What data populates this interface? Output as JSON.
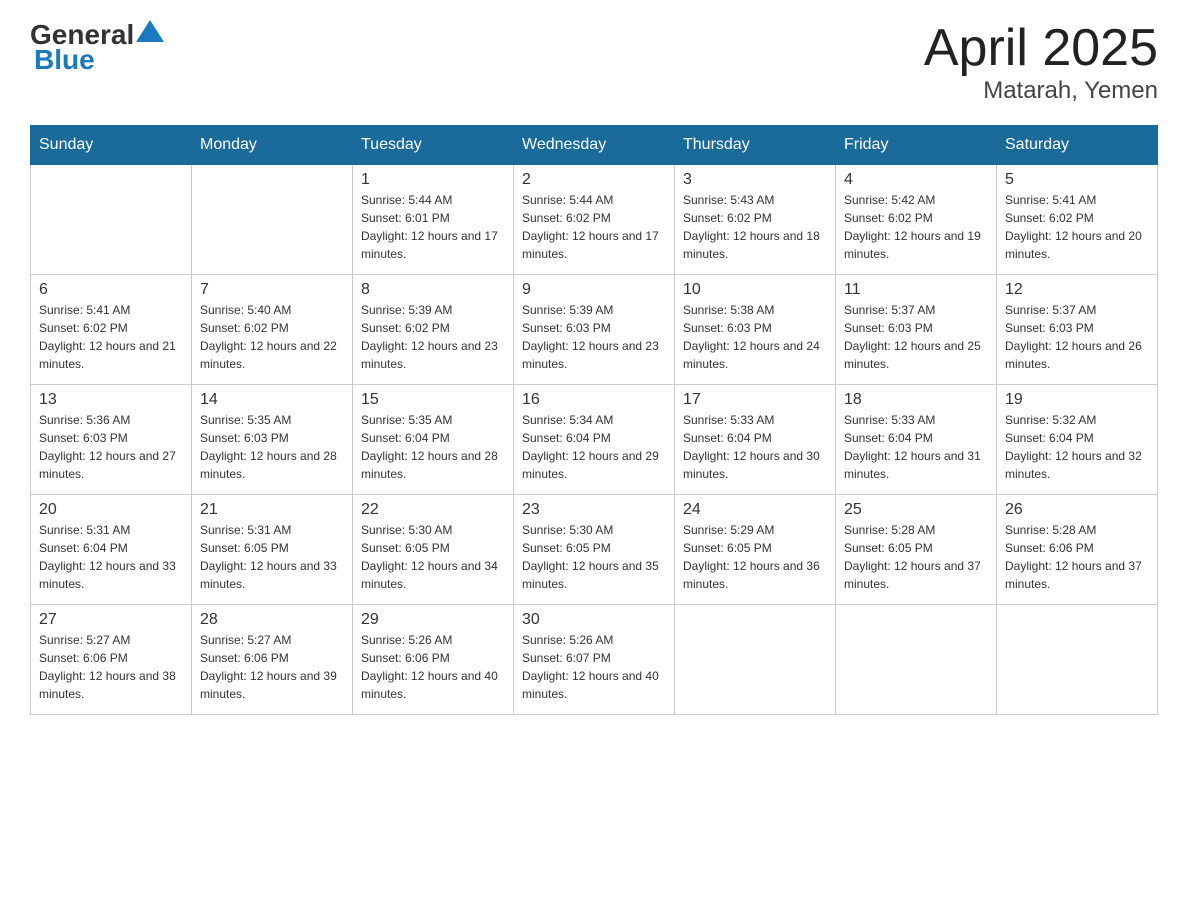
{
  "header": {
    "logo_general": "General",
    "logo_blue": "Blue",
    "title": "April 2025",
    "subtitle": "Matarah, Yemen"
  },
  "days_of_week": [
    "Sunday",
    "Monday",
    "Tuesday",
    "Wednesday",
    "Thursday",
    "Friday",
    "Saturday"
  ],
  "weeks": [
    [
      {
        "day": "",
        "sunrise": "",
        "sunset": "",
        "daylight": ""
      },
      {
        "day": "",
        "sunrise": "",
        "sunset": "",
        "daylight": ""
      },
      {
        "day": "1",
        "sunrise": "Sunrise: 5:44 AM",
        "sunset": "Sunset: 6:01 PM",
        "daylight": "Daylight: 12 hours and 17 minutes."
      },
      {
        "day": "2",
        "sunrise": "Sunrise: 5:44 AM",
        "sunset": "Sunset: 6:02 PM",
        "daylight": "Daylight: 12 hours and 17 minutes."
      },
      {
        "day": "3",
        "sunrise": "Sunrise: 5:43 AM",
        "sunset": "Sunset: 6:02 PM",
        "daylight": "Daylight: 12 hours and 18 minutes."
      },
      {
        "day": "4",
        "sunrise": "Sunrise: 5:42 AM",
        "sunset": "Sunset: 6:02 PM",
        "daylight": "Daylight: 12 hours and 19 minutes."
      },
      {
        "day": "5",
        "sunrise": "Sunrise: 5:41 AM",
        "sunset": "Sunset: 6:02 PM",
        "daylight": "Daylight: 12 hours and 20 minutes."
      }
    ],
    [
      {
        "day": "6",
        "sunrise": "Sunrise: 5:41 AM",
        "sunset": "Sunset: 6:02 PM",
        "daylight": "Daylight: 12 hours and 21 minutes."
      },
      {
        "day": "7",
        "sunrise": "Sunrise: 5:40 AM",
        "sunset": "Sunset: 6:02 PM",
        "daylight": "Daylight: 12 hours and 22 minutes."
      },
      {
        "day": "8",
        "sunrise": "Sunrise: 5:39 AM",
        "sunset": "Sunset: 6:02 PM",
        "daylight": "Daylight: 12 hours and 23 minutes."
      },
      {
        "day": "9",
        "sunrise": "Sunrise: 5:39 AM",
        "sunset": "Sunset: 6:03 PM",
        "daylight": "Daylight: 12 hours and 23 minutes."
      },
      {
        "day": "10",
        "sunrise": "Sunrise: 5:38 AM",
        "sunset": "Sunset: 6:03 PM",
        "daylight": "Daylight: 12 hours and 24 minutes."
      },
      {
        "day": "11",
        "sunrise": "Sunrise: 5:37 AM",
        "sunset": "Sunset: 6:03 PM",
        "daylight": "Daylight: 12 hours and 25 minutes."
      },
      {
        "day": "12",
        "sunrise": "Sunrise: 5:37 AM",
        "sunset": "Sunset: 6:03 PM",
        "daylight": "Daylight: 12 hours and 26 minutes."
      }
    ],
    [
      {
        "day": "13",
        "sunrise": "Sunrise: 5:36 AM",
        "sunset": "Sunset: 6:03 PM",
        "daylight": "Daylight: 12 hours and 27 minutes."
      },
      {
        "day": "14",
        "sunrise": "Sunrise: 5:35 AM",
        "sunset": "Sunset: 6:03 PM",
        "daylight": "Daylight: 12 hours and 28 minutes."
      },
      {
        "day": "15",
        "sunrise": "Sunrise: 5:35 AM",
        "sunset": "Sunset: 6:04 PM",
        "daylight": "Daylight: 12 hours and 28 minutes."
      },
      {
        "day": "16",
        "sunrise": "Sunrise: 5:34 AM",
        "sunset": "Sunset: 6:04 PM",
        "daylight": "Daylight: 12 hours and 29 minutes."
      },
      {
        "day": "17",
        "sunrise": "Sunrise: 5:33 AM",
        "sunset": "Sunset: 6:04 PM",
        "daylight": "Daylight: 12 hours and 30 minutes."
      },
      {
        "day": "18",
        "sunrise": "Sunrise: 5:33 AM",
        "sunset": "Sunset: 6:04 PM",
        "daylight": "Daylight: 12 hours and 31 minutes."
      },
      {
        "day": "19",
        "sunrise": "Sunrise: 5:32 AM",
        "sunset": "Sunset: 6:04 PM",
        "daylight": "Daylight: 12 hours and 32 minutes."
      }
    ],
    [
      {
        "day": "20",
        "sunrise": "Sunrise: 5:31 AM",
        "sunset": "Sunset: 6:04 PM",
        "daylight": "Daylight: 12 hours and 33 minutes."
      },
      {
        "day": "21",
        "sunrise": "Sunrise: 5:31 AM",
        "sunset": "Sunset: 6:05 PM",
        "daylight": "Daylight: 12 hours and 33 minutes."
      },
      {
        "day": "22",
        "sunrise": "Sunrise: 5:30 AM",
        "sunset": "Sunset: 6:05 PM",
        "daylight": "Daylight: 12 hours and 34 minutes."
      },
      {
        "day": "23",
        "sunrise": "Sunrise: 5:30 AM",
        "sunset": "Sunset: 6:05 PM",
        "daylight": "Daylight: 12 hours and 35 minutes."
      },
      {
        "day": "24",
        "sunrise": "Sunrise: 5:29 AM",
        "sunset": "Sunset: 6:05 PM",
        "daylight": "Daylight: 12 hours and 36 minutes."
      },
      {
        "day": "25",
        "sunrise": "Sunrise: 5:28 AM",
        "sunset": "Sunset: 6:05 PM",
        "daylight": "Daylight: 12 hours and 37 minutes."
      },
      {
        "day": "26",
        "sunrise": "Sunrise: 5:28 AM",
        "sunset": "Sunset: 6:06 PM",
        "daylight": "Daylight: 12 hours and 37 minutes."
      }
    ],
    [
      {
        "day": "27",
        "sunrise": "Sunrise: 5:27 AM",
        "sunset": "Sunset: 6:06 PM",
        "daylight": "Daylight: 12 hours and 38 minutes."
      },
      {
        "day": "28",
        "sunrise": "Sunrise: 5:27 AM",
        "sunset": "Sunset: 6:06 PM",
        "daylight": "Daylight: 12 hours and 39 minutes."
      },
      {
        "day": "29",
        "sunrise": "Sunrise: 5:26 AM",
        "sunset": "Sunset: 6:06 PM",
        "daylight": "Daylight: 12 hours and 40 minutes."
      },
      {
        "day": "30",
        "sunrise": "Sunrise: 5:26 AM",
        "sunset": "Sunset: 6:07 PM",
        "daylight": "Daylight: 12 hours and 40 minutes."
      },
      {
        "day": "",
        "sunrise": "",
        "sunset": "",
        "daylight": ""
      },
      {
        "day": "",
        "sunrise": "",
        "sunset": "",
        "daylight": ""
      },
      {
        "day": "",
        "sunrise": "",
        "sunset": "",
        "daylight": ""
      }
    ]
  ]
}
